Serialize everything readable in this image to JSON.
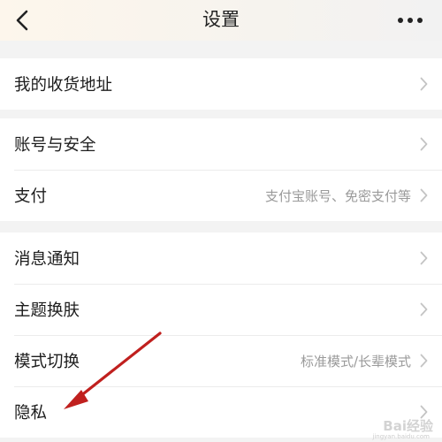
{
  "header": {
    "title": "设置",
    "back_icon": "chevron-left-icon",
    "more_icon": "more-dots-icon"
  },
  "sections": [
    {
      "rows": [
        {
          "label": "我的收货地址",
          "value": ""
        }
      ]
    },
    {
      "rows": [
        {
          "label": "账号与安全",
          "value": ""
        },
        {
          "label": "支付",
          "value": "支付宝账号、免密支付等"
        }
      ]
    },
    {
      "rows": [
        {
          "label": "消息通知",
          "value": ""
        },
        {
          "label": "主题换肤",
          "value": ""
        },
        {
          "label": "模式切换",
          "value": "标准模式/长辈模式"
        },
        {
          "label": "隐私",
          "value": ""
        }
      ]
    }
  ],
  "annotation": {
    "arrow_color": "#c0201e",
    "points_to": "隐私"
  },
  "watermark": {
    "text": "Bai经验",
    "sub": "jingyan.baidu.com"
  },
  "colors": {
    "page_bg": "#f3f3f3",
    "row_bg": "#ffffff",
    "secondary_text": "#9a9a9a"
  }
}
